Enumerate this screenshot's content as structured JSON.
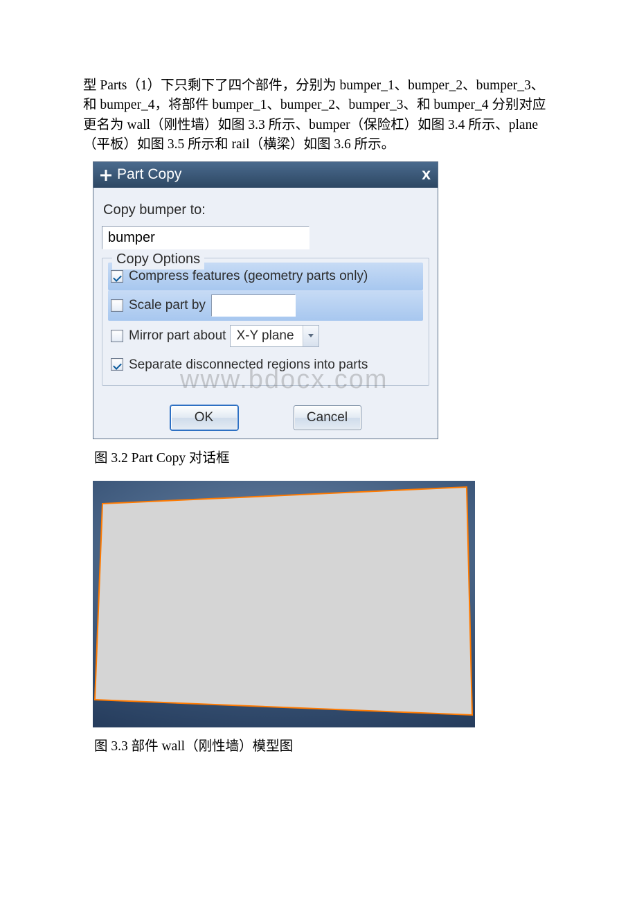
{
  "paragraph": "型 Parts（1）下只剩下了四个部件，分别为 bumper_1、bumper_2、bumper_3、和 bumper_4，将部件 bumper_1、bumper_2、bumper_3、和 bumper_4 分别对应更名为 wall（刚性墙）如图 3.3 所示、bumper（保险杠）如图 3.4 所示、plane（平板）如图 3.5 所示和 rail（横梁）如图 3.6 所示。",
  "dialog": {
    "title": "Part Copy",
    "close": "x",
    "instruction": "Copy bumper to:",
    "input_value": "bumper",
    "group_legend": "Copy Options",
    "opt_compress": "Compress features (geometry parts only)",
    "opt_scale": "Scale part by",
    "opt_mirror": "Mirror part about",
    "mirror_plane": "X-Y plane",
    "opt_separate": "Separate disconnected regions into parts",
    "ok": "OK",
    "cancel": "Cancel"
  },
  "watermark": "www.bdocx.com",
  "caption_dialog": "图 3.2 Part Copy 对话框",
  "caption_fig33": "图 3.3 部件 wall（刚性墙）模型图"
}
